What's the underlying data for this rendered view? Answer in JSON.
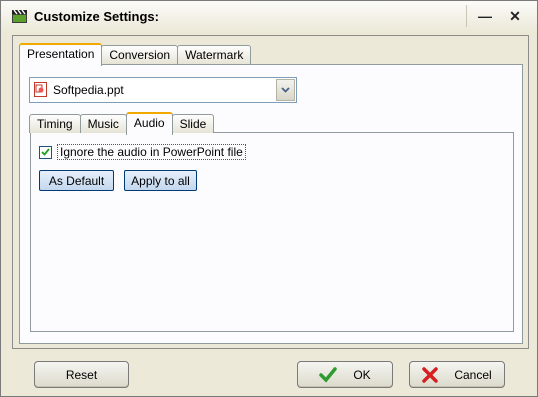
{
  "window": {
    "title": "Customize Settings:",
    "minimize_glyph": "—",
    "close_glyph": "✕"
  },
  "top_tabs": [
    {
      "label": "Presentation",
      "active": true
    },
    {
      "label": "Conversion",
      "active": false
    },
    {
      "label": "Watermark",
      "active": false
    }
  ],
  "file_select": {
    "value": "Softpedia.ppt",
    "icon": "powerpoint-file-icon"
  },
  "inner_tabs": [
    {
      "label": "Timing",
      "active": false
    },
    {
      "label": "Music",
      "active": false
    },
    {
      "label": "Audio",
      "active": true
    },
    {
      "label": "Slide",
      "active": false
    }
  ],
  "audio": {
    "ignore_audio_label": "Ignore the audio in PowerPoint file",
    "ignore_audio_checked": true,
    "as_default_label": "As Default",
    "apply_to_all_label": "Apply to all"
  },
  "footer": {
    "reset_label": "Reset",
    "ok_label": "OK",
    "cancel_label": "Cancel"
  },
  "colors": {
    "active_tab_accent": "#f1a900",
    "ok_check": "#2e9b2e",
    "cancel_x": "#d42020"
  }
}
